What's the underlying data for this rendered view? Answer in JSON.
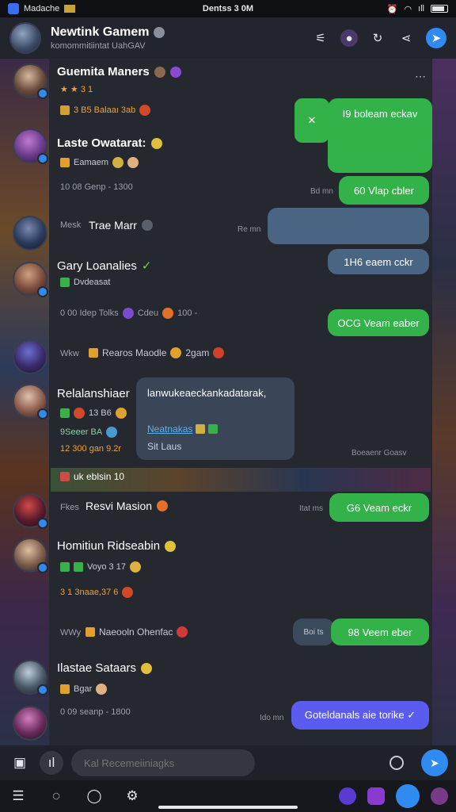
{
  "status_bar": {
    "app_label": "Madache",
    "time": "Dentss 3 0M",
    "battery": "ıll"
  },
  "header": {
    "title": "Newtink Gamem",
    "subtitle": "komommitiintat UahGAV"
  },
  "chats": [
    {
      "name": "Guemita Maners",
      "meta1": "★ ★ 3 1",
      "meta2": "3 B5 Balaaı 3ab",
      "bubble": "I9 boleam eckav",
      "bubble_color": "green"
    },
    {
      "name": "Laste Owatarat:",
      "meta1": "Eamaem",
      "meta2": "10 08 Genp - 1300",
      "ts": "Bd mn",
      "bubble": "60 Vlap cbler",
      "bubble_color": "green"
    },
    {
      "name": "Trae Marr",
      "meta_prefix": "Mesk",
      "ts": "Re mn",
      "bubble": "",
      "bubble_color": "blue"
    },
    {
      "name": "Gary Loanalies",
      "meta1": "Dvdeasat",
      "meta2": "0 00 Idep Tolks",
      "meta2b": "Cdeu",
      "meta2c": "100 -",
      "bubble": "1H6 eaem cckr",
      "bubble_color": "blue",
      "bubble2": "OCG Veam eaber",
      "bubble2_color": "green"
    },
    {
      "name": "Rearos Maodle",
      "meta_prefix": "Wkw",
      "meta_suffix": "2gam"
    },
    {
      "name": "Relalanshiaer",
      "meta1": "13 B6",
      "meta2": "9Seeer BA",
      "meta3": "12 300 gan 9.2r",
      "card_line1": "lanwukeaeckankadatarak,",
      "card_link": "Neatnakas",
      "card_line3": "Sit Laus",
      "card_ts": "Boeaenr Goasv"
    },
    {
      "name": "Resvi Masion",
      "meta_prefix": "Fkes",
      "banner": "uk eblsin 10",
      "ts": "Itat ms",
      "bubble": "G6 Veam eckr",
      "bubble_color": "green"
    },
    {
      "name": "Homitiun Ridseabin",
      "meta1": "Voyo 3 17",
      "meta2": "3 1 3naae,37 6"
    },
    {
      "name": "Naeooln Ohenfac",
      "meta_prefix": "WWy",
      "ts": "Boi ts",
      "bubble": "98 Veem eber",
      "bubble_color": "green"
    },
    {
      "name": "Ilastae Sataars",
      "meta1": "Bgar",
      "meta2": "0 09 seanp - 1800",
      "ts": "Ido mn",
      "bubble": "Goteldanals aie torike ✓",
      "bubble_color": "purple"
    }
  ],
  "composer": {
    "placeholder": "Kal Recemeiiniagks"
  },
  "colors": {
    "accent": "#2f8bf0",
    "green": "#34b24a",
    "blue_bubble": "#4a6583",
    "purple_bubble": "#5a5cf0",
    "panel": "#262830"
  }
}
